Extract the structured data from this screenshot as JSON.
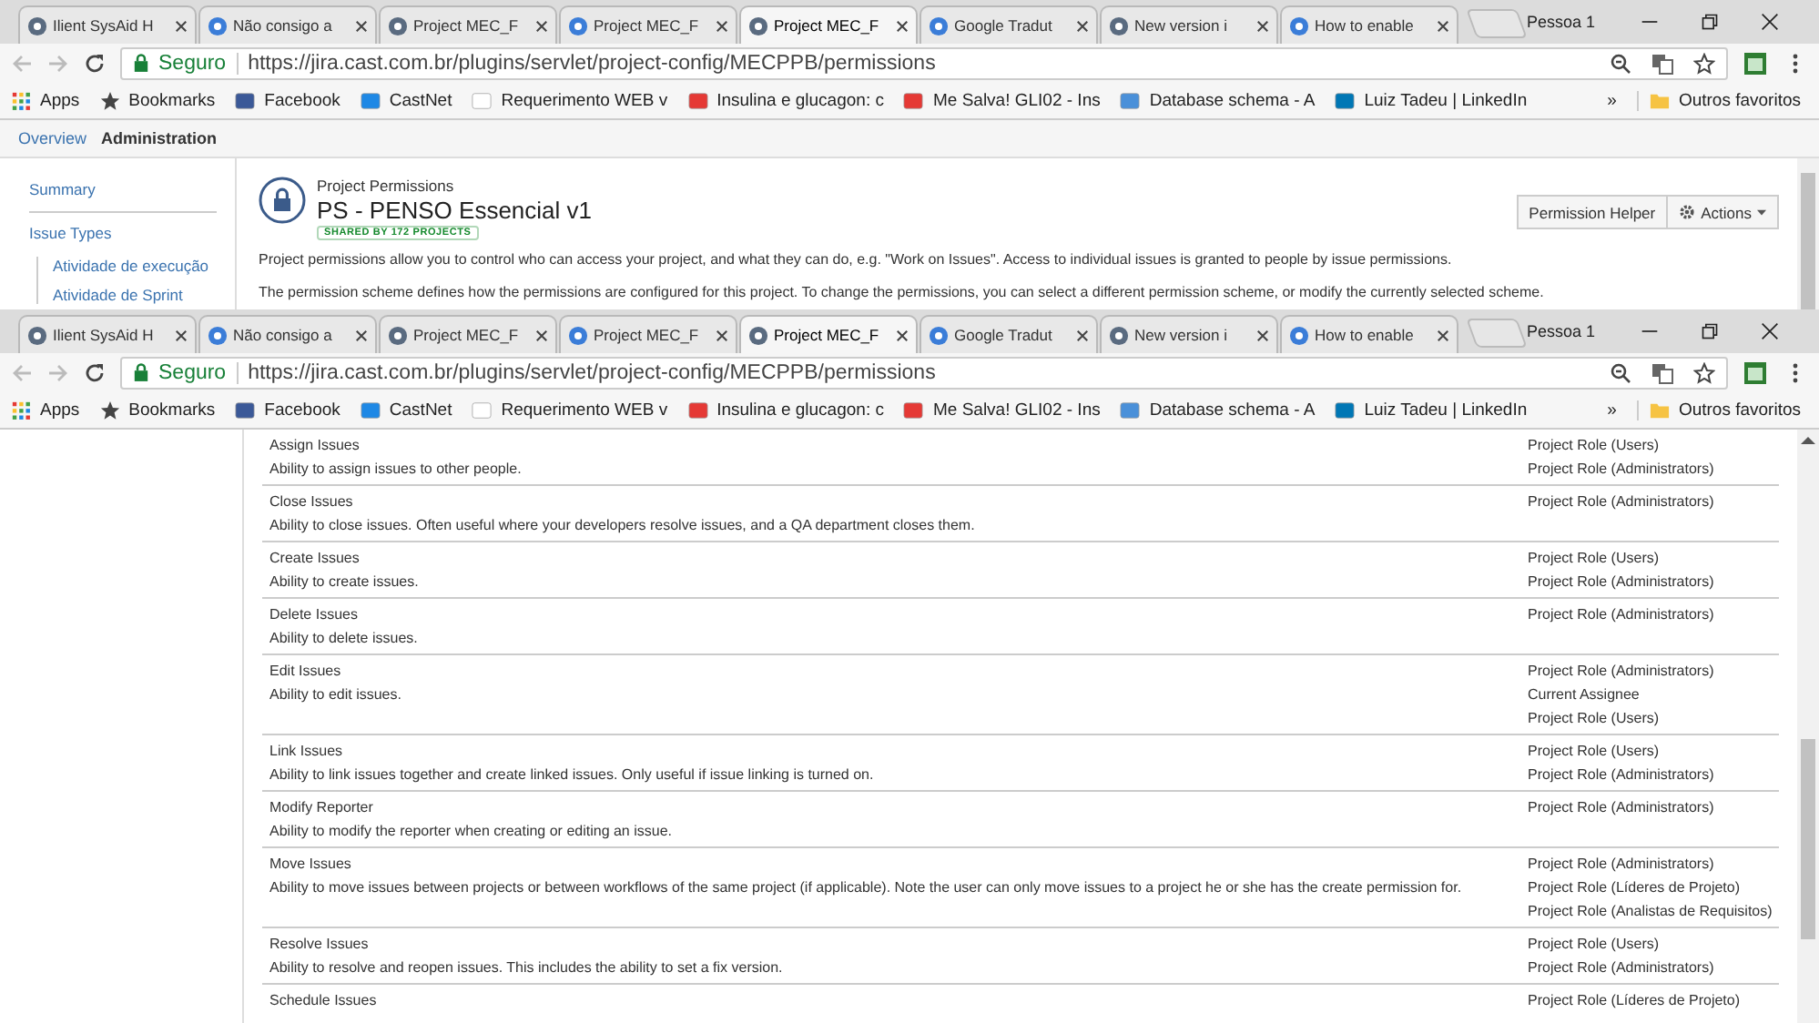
{
  "windows": [
    {
      "tabs": [
        {
          "title": "Ilient SysAid H",
          "selected": false
        },
        {
          "title": "Não consigo a",
          "selected": false
        },
        {
          "title": "Project MEC_F",
          "selected": false
        },
        {
          "title": "Project MEC_F",
          "selected": false
        },
        {
          "title": "Project MEC_F",
          "selected": true
        },
        {
          "title": "Google Tradut",
          "selected": false
        },
        {
          "title": "New version i",
          "selected": false
        },
        {
          "title": "How to enable",
          "selected": false
        }
      ],
      "profile": "Pessoa 1",
      "security_label": "Seguro",
      "url": "https://jira.cast.com.br/plugins/servlet/project-config/MECPPB/permissions",
      "bookmarks": [
        "Apps",
        "Bookmarks",
        "Facebook",
        "CastNet",
        "Requerimento WEB v",
        "Insulina e glucagon: c",
        "Me Salva! GLI02 - Ins",
        "Database schema - A",
        "Luiz Tadeu | LinkedIn"
      ],
      "more": "»",
      "other_bookmarks": "Outros favoritos",
      "page": {
        "kind": "header",
        "nav": [
          {
            "label": "Overview",
            "selected": false
          },
          {
            "label": "Administration",
            "selected": true
          }
        ],
        "sidebar": [
          {
            "label": "Summary"
          },
          {
            "label": "Issue Types",
            "children": [
              {
                "label": "Atividade de execução"
              },
              {
                "label": "Atividade de Sprint"
              }
            ]
          }
        ],
        "subtitle": "Project Permissions",
        "title": "PS - PENSO Essencial v1",
        "lozenge": "SHARED BY 172 PROJECTS",
        "helper_button": "Permission Helper",
        "actions_button": "Actions",
        "paragraphs": [
          "Project permissions allow you to control who can access your project, and what they can do, e.g. \"Work on Issues\". Access to individual issues is granted to people by issue permissions.",
          "The permission scheme defines how the permissions are configured for this project. To change the permissions, you can select a different permission scheme, or modify the currently selected scheme."
        ]
      }
    },
    {
      "tabs": [
        {
          "title": "Ilient SysAid H",
          "selected": false
        },
        {
          "title": "Não consigo a",
          "selected": false
        },
        {
          "title": "Project MEC_F",
          "selected": false
        },
        {
          "title": "Project MEC_F",
          "selected": false
        },
        {
          "title": "Project MEC_F",
          "selected": true
        },
        {
          "title": "Google Tradut",
          "selected": false
        },
        {
          "title": "New version i",
          "selected": false
        },
        {
          "title": "How to enable",
          "selected": false
        }
      ],
      "profile": "Pessoa 1",
      "security_label": "Seguro",
      "url": "https://jira.cast.com.br/plugins/servlet/project-config/MECPPB/permissions",
      "bookmarks": [
        "Apps",
        "Bookmarks",
        "Facebook",
        "CastNet",
        "Requerimento WEB v",
        "Insulina e glucagon: c",
        "Me Salva! GLI02 - Ins",
        "Database schema - A",
        "Luiz Tadeu | LinkedIn"
      ],
      "more": "»",
      "other_bookmarks": "Outros favoritos",
      "page": {
        "kind": "permissions",
        "rows": [
          {
            "name": "Assign Issues",
            "description": "Ability to assign issues to other people.",
            "grants": [
              "Project Role (Users)",
              "Project Role (Administrators)"
            ]
          },
          {
            "name": "Close Issues",
            "description": "Ability to close issues. Often useful where your developers resolve issues, and a QA department closes them.",
            "grants": [
              "Project Role (Administrators)"
            ]
          },
          {
            "name": "Create Issues",
            "description": "Ability to create issues.",
            "grants": [
              "Project Role (Users)",
              "Project Role (Administrators)"
            ]
          },
          {
            "name": "Delete Issues",
            "description": "Ability to delete issues.",
            "grants": [
              "Project Role (Administrators)"
            ]
          },
          {
            "name": "Edit Issues",
            "description": "Ability to edit issues.",
            "grants": [
              "Project Role (Administrators)",
              "Current Assignee",
              "Project Role (Users)"
            ]
          },
          {
            "name": "Link Issues",
            "description": "Ability to link issues together and create linked issues. Only useful if issue linking is turned on.",
            "grants": [
              "Project Role (Users)",
              "Project Role (Administrators)"
            ]
          },
          {
            "name": "Modify Reporter",
            "description": "Ability to modify the reporter when creating or editing an issue.",
            "grants": [
              "Project Role (Administrators)"
            ]
          },
          {
            "name": "Move Issues",
            "description": "Ability to move issues between projects or between workflows of the same project (if applicable). Note the user can only move issues to a project he or she has the create permission for.",
            "grants": [
              "Project Role (Administrators)",
              "Project Role (Líderes de Projeto)",
              "Project Role (Analistas de Requisitos)"
            ]
          },
          {
            "name": "Resolve Issues",
            "description": "Ability to resolve and reopen issues. This includes the ability to set a fix version.",
            "grants": [
              "Project Role (Users)",
              "Project Role (Administrators)"
            ]
          },
          {
            "name": "Schedule Issues",
            "description": "",
            "grants": [
              "Project Role (Líderes de Projeto)"
            ]
          }
        ]
      }
    }
  ]
}
